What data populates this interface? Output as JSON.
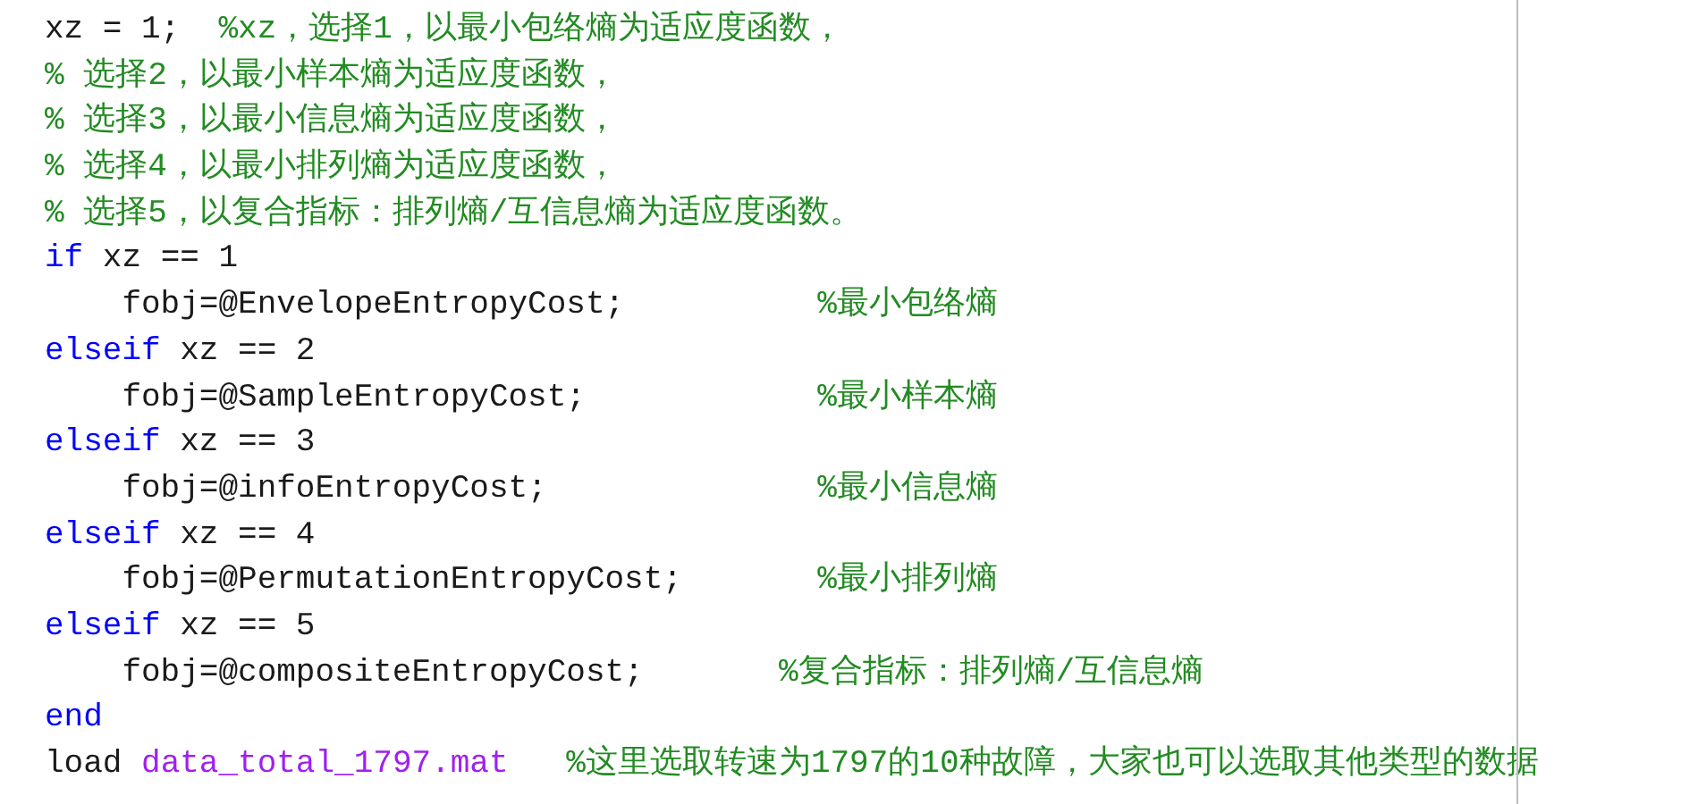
{
  "editor": {
    "lines": [
      [
        {
          "kind": "code",
          "text": "xz = 1;  "
        },
        {
          "kind": "comment",
          "text": "%xz，选择1，以最小包络熵为适应度函数，"
        }
      ],
      [
        {
          "kind": "comment",
          "text": "% 选择2，以最小样本熵为适应度函数，"
        }
      ],
      [
        {
          "kind": "comment",
          "text": "% 选择3，以最小信息熵为适应度函数，"
        }
      ],
      [
        {
          "kind": "comment",
          "text": "% 选择4，以最小排列熵为适应度函数，"
        }
      ],
      [
        {
          "kind": "comment",
          "text": "% 选择5，以复合指标：排列熵/互信息熵为适应度函数。"
        }
      ],
      [
        {
          "kind": "keyword",
          "text": "if"
        },
        {
          "kind": "code",
          "text": " xz == 1"
        }
      ],
      [
        {
          "kind": "code",
          "text": "    fobj=@EnvelopeEntropyCost;          "
        },
        {
          "kind": "comment",
          "text": "%最小包络熵"
        }
      ],
      [
        {
          "kind": "keyword",
          "text": "elseif"
        },
        {
          "kind": "code",
          "text": " xz == 2"
        }
      ],
      [
        {
          "kind": "code",
          "text": "    fobj=@SampleEntropyCost;            "
        },
        {
          "kind": "comment",
          "text": "%最小样本熵"
        }
      ],
      [
        {
          "kind": "keyword",
          "text": "elseif"
        },
        {
          "kind": "code",
          "text": " xz == 3"
        }
      ],
      [
        {
          "kind": "code",
          "text": "    fobj=@infoEntropyCost;              "
        },
        {
          "kind": "comment",
          "text": "%最小信息熵"
        }
      ],
      [
        {
          "kind": "keyword",
          "text": "elseif"
        },
        {
          "kind": "code",
          "text": " xz == 4"
        }
      ],
      [
        {
          "kind": "code",
          "text": "    fobj=@PermutationEntropyCost;       "
        },
        {
          "kind": "comment",
          "text": "%最小排列熵"
        }
      ],
      [
        {
          "kind": "keyword",
          "text": "elseif"
        },
        {
          "kind": "code",
          "text": " xz == 5"
        }
      ],
      [
        {
          "kind": "code",
          "text": "    fobj=@compositeEntropyCost;       "
        },
        {
          "kind": "comment",
          "text": "%复合指标：排列熵/互信息熵"
        }
      ],
      [
        {
          "kind": "keyword",
          "text": "end"
        }
      ],
      [
        {
          "kind": "code",
          "text": "load "
        },
        {
          "kind": "string",
          "text": "data_total_1797.mat"
        },
        {
          "kind": "comment",
          "text": "   %这里选取转速为1797的10种故障，大家也可以选取其他类型的数据"
        }
      ]
    ]
  }
}
